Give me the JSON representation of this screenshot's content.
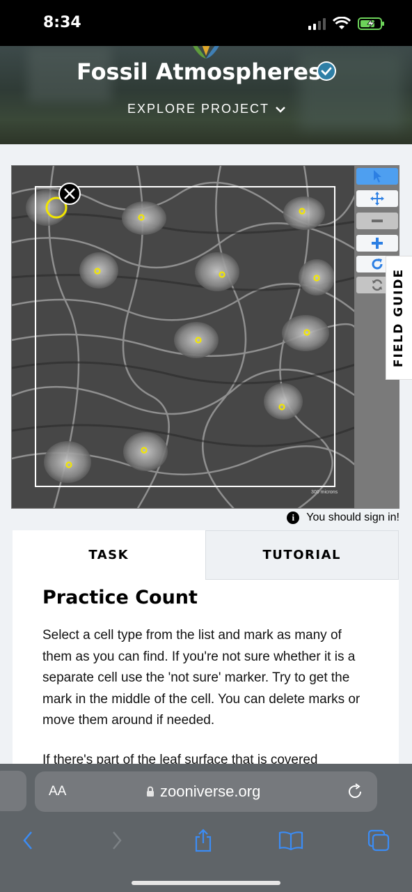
{
  "status_bar": {
    "time": "8:34"
  },
  "header": {
    "project_title": "Fossil Atmospheres",
    "explore_label": "EXPLORE PROJECT"
  },
  "viewer": {
    "scale_label": "300 microns",
    "toolbar": [
      "pointer-tool",
      "move-tool",
      "zoom-out",
      "zoom-in",
      "rotate",
      "reset"
    ]
  },
  "field_guide_label": "FIELD GUIDE",
  "sign_in_notice": "You should sign in!",
  "tabs": [
    {
      "label": "TASK",
      "active": true
    },
    {
      "label": "TUTORIAL",
      "active": false
    }
  ],
  "task": {
    "title": "Practice Count",
    "paragraphs": [
      "Select a cell type from the list and mark as many of them as you can find. If you're not sure whether it is a separate cell use the 'not sure' marker. Try to get the mark in the middle of the cell. You can delete marks or move them around if needed.",
      "If there's part of the leaf surface that is covered"
    ]
  },
  "browser": {
    "aa_label": "AA",
    "url": "zooniverse.org"
  },
  "colors": {
    "accent_blue": "#4e9ff0",
    "marker_yellow": "#f2e600",
    "ios_blue": "#3b8cf5"
  }
}
